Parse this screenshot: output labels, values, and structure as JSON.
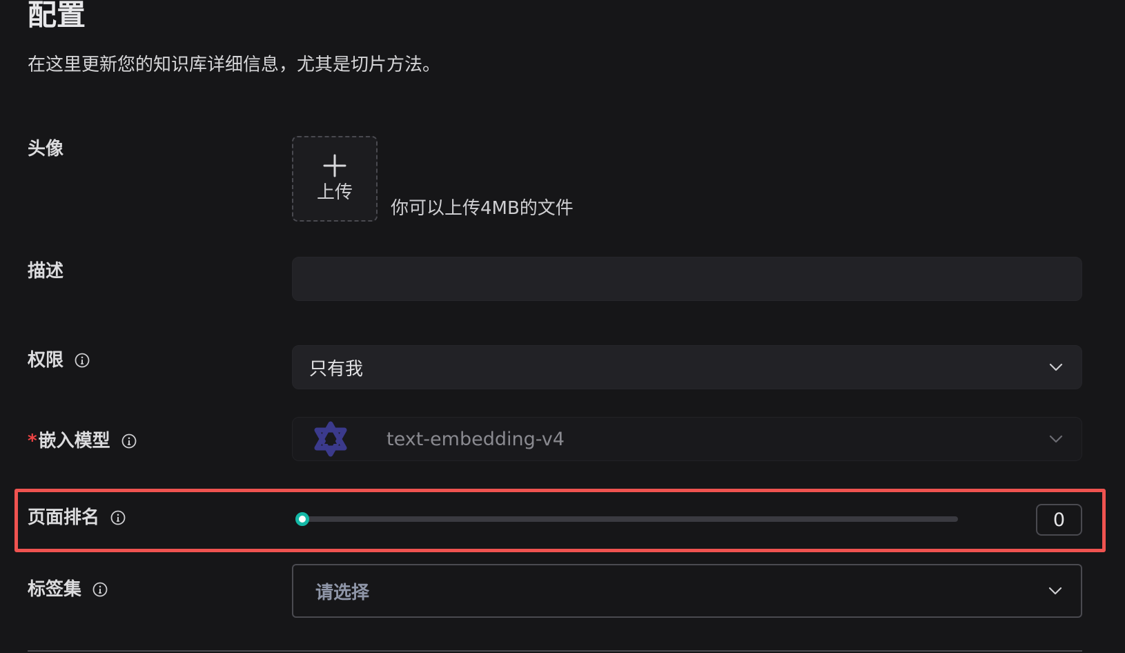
{
  "header": {
    "title": "配置",
    "subtitle": "在这里更新您的知识库详细信息，尤其是切片方法。"
  },
  "avatar_row": {
    "label": "头像",
    "upload_label": "上传",
    "upload_hint": "你可以上传4MB的文件",
    "plus_icon": "plus-icon"
  },
  "description_row": {
    "label": "描述",
    "value": "",
    "placeholder": ""
  },
  "permission_row": {
    "label": "权限",
    "icon": "info-icon",
    "selected": "只有我",
    "chevron_icon": "chevron-down-icon"
  },
  "embedding_row": {
    "required_mark": "*",
    "label": "嵌入模型",
    "icon": "info-icon",
    "model_logo": "qwen-logo-icon",
    "selected": "text-embedding-v4",
    "disabled": true
  },
  "page_rank_row": {
    "label": "页面排名",
    "icon": "info-icon",
    "slider_value": 0,
    "value_display": "0",
    "highlighted": true
  },
  "tagset_row": {
    "label": "标签集",
    "icon": "info-icon",
    "placeholder": "请选择"
  },
  "colors": {
    "background": "#161618",
    "field_bg": "#222226",
    "accent_slider": "#14b8a6",
    "highlight_border": "#ef5350",
    "required": "#ef4444",
    "embed_logo": "#3b3a8c"
  }
}
